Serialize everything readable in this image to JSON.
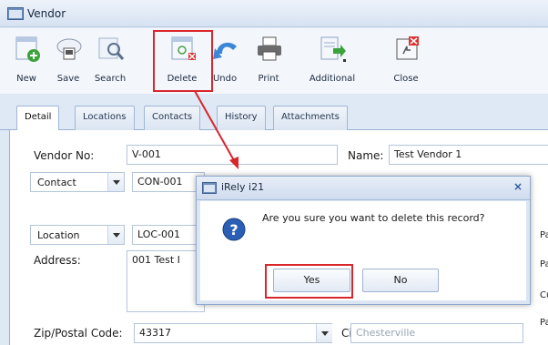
{
  "window": {
    "title": "Vendor"
  },
  "toolbar": {
    "buttons": [
      {
        "label": "New",
        "icon": "new-document-icon"
      },
      {
        "label": "Save",
        "icon": "save-cloud-icon"
      },
      {
        "label": "Search",
        "icon": "search-icon"
      },
      {
        "label": "Delete",
        "icon": "delete-icon"
      },
      {
        "label": "Undo",
        "icon": "undo-icon"
      },
      {
        "label": "Print",
        "icon": "print-icon"
      },
      {
        "label": "Additional",
        "icon": "additional-icon"
      },
      {
        "label": "Close",
        "icon": "close-icon"
      }
    ]
  },
  "tabs": [
    "Detail",
    "Locations",
    "Contacts",
    "History",
    "Attachments"
  ],
  "form": {
    "vendor_no_label": "Vendor No:",
    "vendor_no": "V-001",
    "name_label": "Name:",
    "name": "Test Vendor 1",
    "contact_combo": "Contact",
    "contact_value": "CON-001",
    "location_combo": "Location",
    "location_value": "LOC-001",
    "address_label": "Address:",
    "address_value": "001 Test I",
    "zip_label": "Zip/Postal Code:",
    "zip_value": "43317",
    "city_label": "City:",
    "city_value": "Chesterville",
    "right_cut": [
      "Payr",
      "Pay",
      "Curr",
      "Payr"
    ]
  },
  "dialog": {
    "title": "iRely i21",
    "message": "Are you sure you want to delete this record?",
    "yes_label": "Yes",
    "no_label": "No",
    "close_glyph": "×"
  },
  "colors": {
    "highlight": "#d9262c",
    "accent": "#2d5aa0"
  }
}
